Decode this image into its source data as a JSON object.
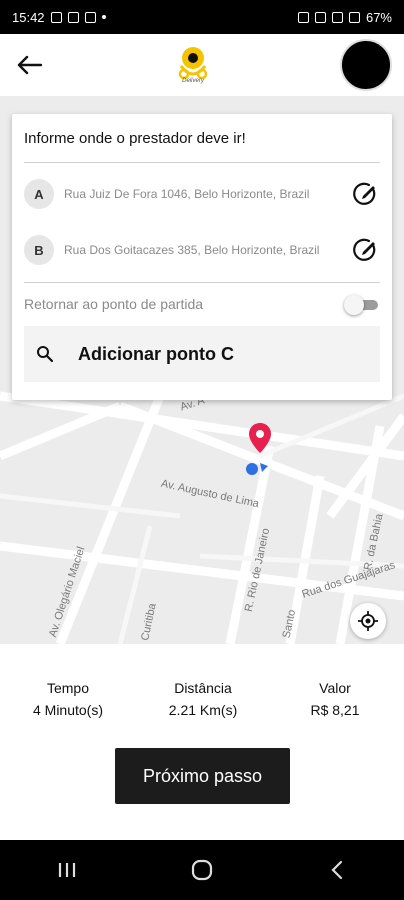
{
  "status": {
    "time": "15:42",
    "battery": "67%"
  },
  "header": {
    "logo_text": "Delivery",
    "back_icon": "arrow-left-icon"
  },
  "map": {
    "streets": [
      "Av. A",
      "Av. Augusto de Lima",
      "Av. Olegário Maciel",
      "R. Rio de Janeiro",
      "Rua dos Guajajaras",
      "R. da Bahia",
      "Curitiba",
      "Santo"
    ],
    "pin_color": "#e8204d",
    "location_color": "#2f6fe4"
  },
  "route_card": {
    "title": "Informe onde o prestador deve ir!",
    "stops": [
      {
        "letter": "A",
        "address": "Rua Juiz De Fora 1046, Belo Horizonte, Brazil"
      },
      {
        "letter": "B",
        "address": "Rua Dos Goitacazes 385, Belo Horizonte, Brazil"
      }
    ],
    "return_label": "Retornar ao ponto de partida",
    "return_enabled": false,
    "add_point_label": "Adicionar ponto C"
  },
  "summary": {
    "time_label": "Tempo",
    "time_value": "4 Minuto(s)",
    "distance_label": "Distância",
    "distance_value": "2.21 Km(s)",
    "price_label": "Valor",
    "price_value": "R$ 8,21"
  },
  "next_button": "Próximo passo",
  "colors": {
    "accent": "#f5c400",
    "button_bg": "#1c1c1c"
  }
}
